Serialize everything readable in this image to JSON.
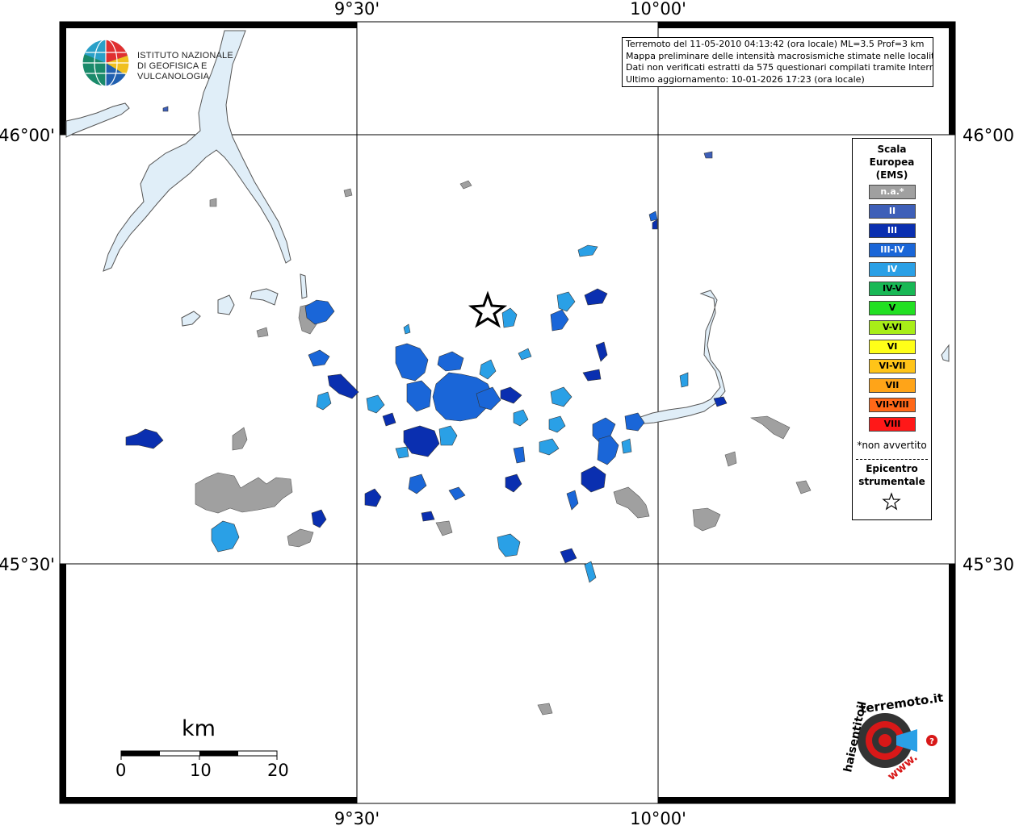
{
  "axes": {
    "top_lon_labels": [
      "9°30'",
      "10°00'"
    ],
    "bottom_lon_labels": [
      "9°30'",
      "10°00'"
    ],
    "left_lat_labels": [
      "46°00'",
      "45°30'"
    ],
    "right_lat_labels": [
      "46°00'",
      "45°30'"
    ]
  },
  "logo": {
    "line1": "ISTITUTO NAZIONALE",
    "line2": "DI GEOFISICA E VULCANOLOGIA"
  },
  "info": {
    "line1": "Terremoto del 11-05-2010 04:13:42 (ora locale) ML=3.5 Prof=3 km",
    "line2": "Mappa preliminare delle intensità macrosismiche stimate nelle località",
    "line3": "Dati non verificati estratti da 575 questionari compilati tramite Internet.",
    "line4": "Ultimo aggiornamento: 10-01-2026 17:23 (ora locale)"
  },
  "legend": {
    "title_line1": "Scala",
    "title_line2": "Europea",
    "title_line3": "(EMS)",
    "items": [
      {
        "label": "n.a.*",
        "color": "#a0a0a0",
        "text_color": "#ffffff"
      },
      {
        "label": "II",
        "color": "#3e5fb8",
        "text_color": "#ffffff"
      },
      {
        "label": "III",
        "color": "#0a2fb0",
        "text_color": "#ffffff"
      },
      {
        "label": "III-IV",
        "color": "#1a66d8",
        "text_color": "#ffffff"
      },
      {
        "label": "IV",
        "color": "#2aa0e6",
        "text_color": "#ffffff"
      },
      {
        "label": "IV-V",
        "color": "#18b855",
        "text_color": "#000000"
      },
      {
        "label": "V",
        "color": "#22e022",
        "text_color": "#000000"
      },
      {
        "label": "V-VI",
        "color": "#a8ee18",
        "text_color": "#000000"
      },
      {
        "label": "VI",
        "color": "#ffff18",
        "text_color": "#000000"
      },
      {
        "label": "VI-VII",
        "color": "#ffc418",
        "text_color": "#000000"
      },
      {
        "label": "VII",
        "color": "#ffa418",
        "text_color": "#000000"
      },
      {
        "label": "VII-VIII",
        "color": "#ff6818",
        "text_color": "#000000"
      },
      {
        "label": "VIII",
        "color": "#ff1818",
        "text_color": "#000000"
      }
    ],
    "note": "*non avvertito",
    "epicenter_line1": "Epicentro",
    "epicenter_line2": "strumentale"
  },
  "scale_bar": {
    "unit": "km",
    "ticks": [
      "0",
      "10",
      "20"
    ]
  },
  "hs_logo": {
    "text_top": "terremoto.it",
    "text_left": "haisentitoil",
    "text_bottom": "www.",
    "question": "?"
  },
  "colors": {
    "lake": "#e0eef8",
    "na": "#a0a0a0",
    "ii": "#3e5fb8",
    "iii": "#0a2fb0",
    "iii_iv": "#1a66d8",
    "iv": "#2aa0e6"
  }
}
